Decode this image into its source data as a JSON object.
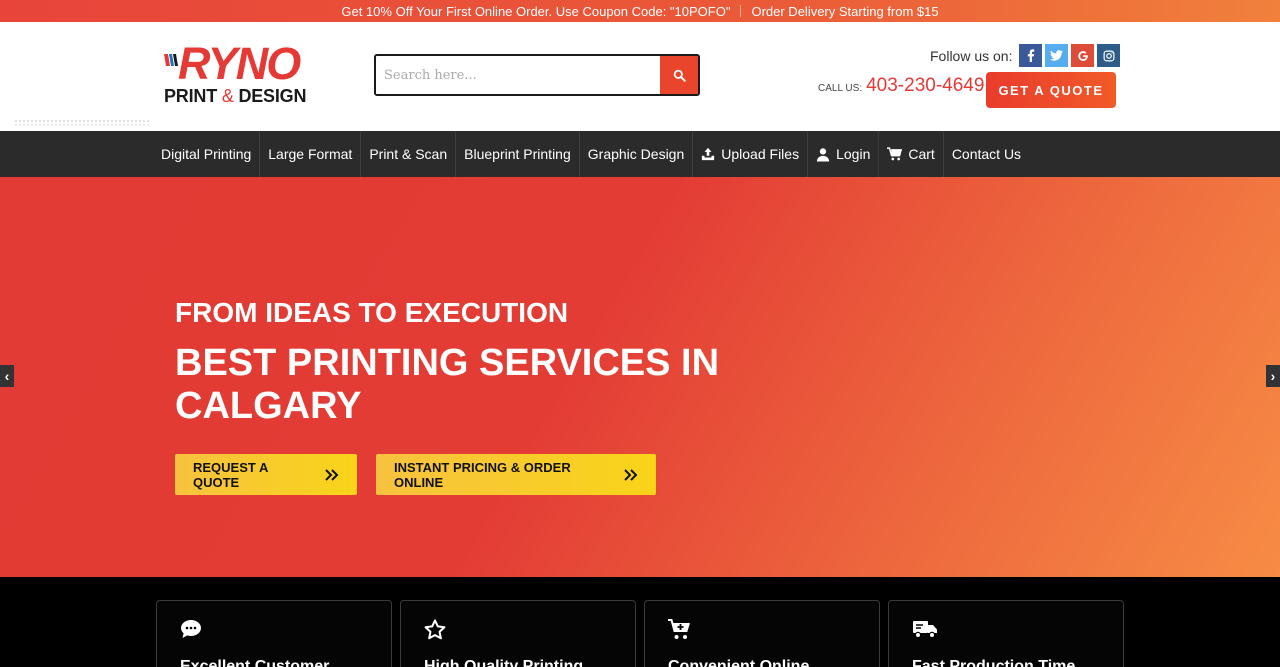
{
  "promo": {
    "left": "Get 10% Off Your First Online Order. Use Coupon Code: \"10POFO\"",
    "right": "Order Delivery Starting from $15"
  },
  "logo": {
    "word": "RYNO",
    "sub_left": "PRINT",
    "sub_amp": "&",
    "sub_right": "DESIGN"
  },
  "search": {
    "placeholder": "Search here..."
  },
  "social": {
    "label": "Follow us on:",
    "icons": [
      "facebook-icon",
      "twitter-icon",
      "google-icon",
      "instagram-icon"
    ]
  },
  "call": {
    "label": "CALL US:",
    "phone": "403-230-4649"
  },
  "quote_button": "GET A QUOTE",
  "nav": {
    "items": [
      {
        "label": "Digital Printing"
      },
      {
        "label": "Large Format"
      },
      {
        "label": "Print & Scan"
      },
      {
        "label": "Blueprint Printing"
      },
      {
        "label": "Graphic Design"
      },
      {
        "label": "Upload Files",
        "icon": "upload-icon"
      },
      {
        "label": "Login",
        "icon": "user-icon"
      },
      {
        "label": "Cart",
        "icon": "cart-icon"
      },
      {
        "label": "Contact Us"
      }
    ]
  },
  "hero": {
    "kicker": "FROM IDEAS TO EXECUTION",
    "title": "BEST PRINTING SERVICES IN CALGARY",
    "cta_primary": "REQUEST A QUOTE",
    "cta_secondary": "INSTANT PRICING & ORDER ONLINE"
  },
  "features": [
    {
      "title": "Excellent Customer",
      "icon": "chat-icon"
    },
    {
      "title": "High Quality Printing",
      "icon": "star-icon"
    },
    {
      "title": "Convenient Online",
      "icon": "cart-plus-icon"
    },
    {
      "title": "Fast Production Time",
      "icon": "truck-icon"
    }
  ],
  "colors": {
    "brand_red": "#e53935",
    "accent_orange": "#f15a28",
    "cta_yellow": "#f9d419",
    "nav_bg": "#2b2b2b"
  }
}
